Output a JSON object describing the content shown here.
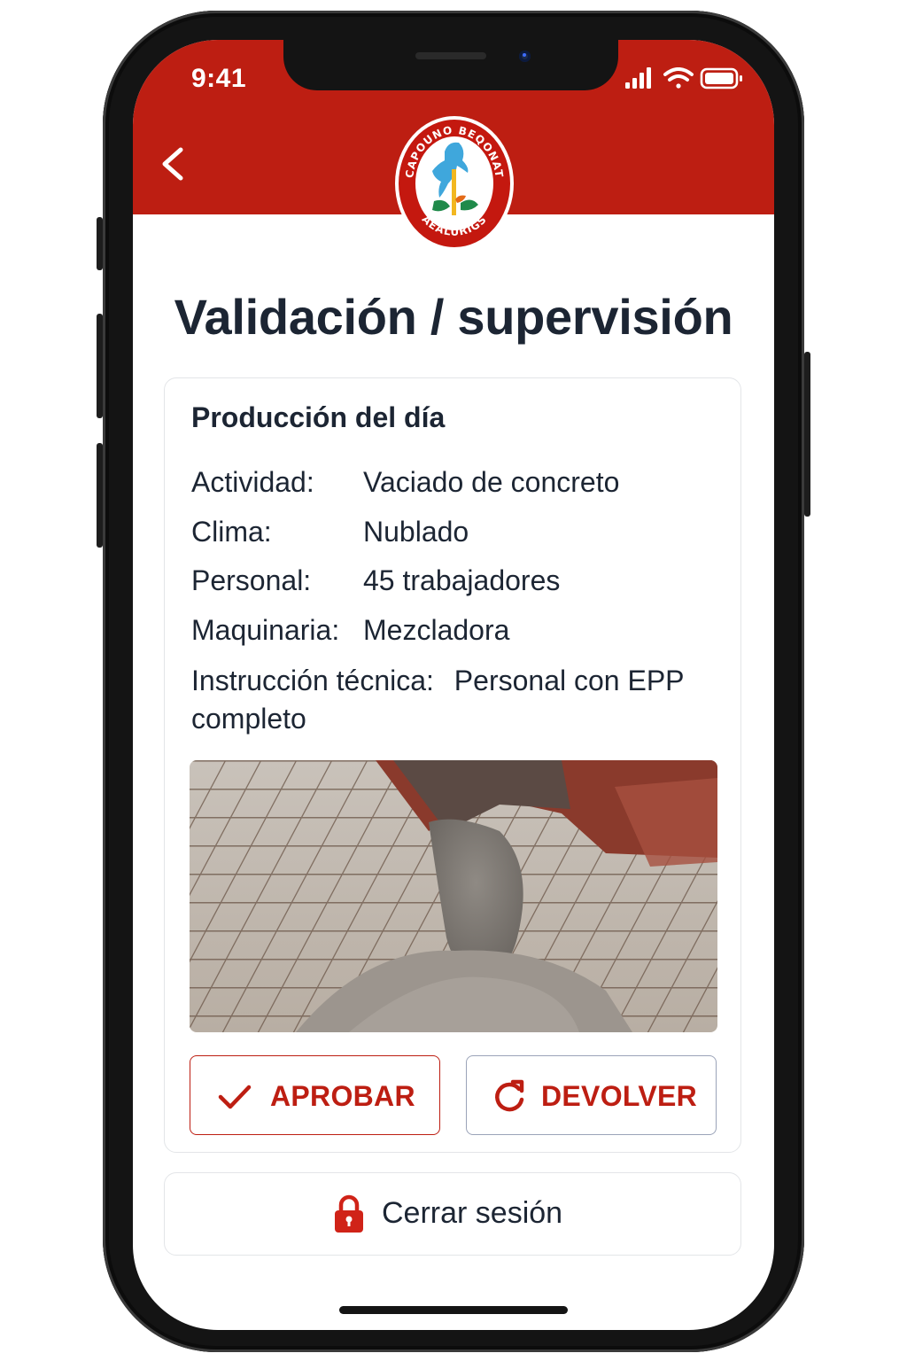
{
  "status_bar": {
    "time": "9:41"
  },
  "header": {
    "logo": {
      "top_text": "CAPOUNO BEQONAT",
      "bottom_text": "AEALURIGS"
    }
  },
  "page": {
    "title": "Validación / supervisión"
  },
  "production": {
    "title": "Producción del día",
    "rows": [
      {
        "label": "Actividad:",
        "value": "Vaciado de concreto"
      },
      {
        "label": "Clima:",
        "value": "Nublado"
      },
      {
        "label": "Personal:",
        "value": "45 trabajadores"
      },
      {
        "label": "Maquinaria:",
        "value": "Mezcladora"
      }
    ],
    "instruction": {
      "label": "Instrucción técnica:",
      "value": "Personal con EPP completo"
    }
  },
  "actions": {
    "approve_label": "APROBAR",
    "return_label": "DEVOLVER"
  },
  "logout": {
    "label": "Cerrar sesión"
  },
  "colors": {
    "brand_red": "#bd1e12",
    "text_dark": "#1c2533",
    "card_border": "#e3e5e8"
  },
  "icons": {
    "back": "chevron-left-icon",
    "approve": "check-icon",
    "return": "refresh-icon",
    "logout": "lock-icon"
  }
}
